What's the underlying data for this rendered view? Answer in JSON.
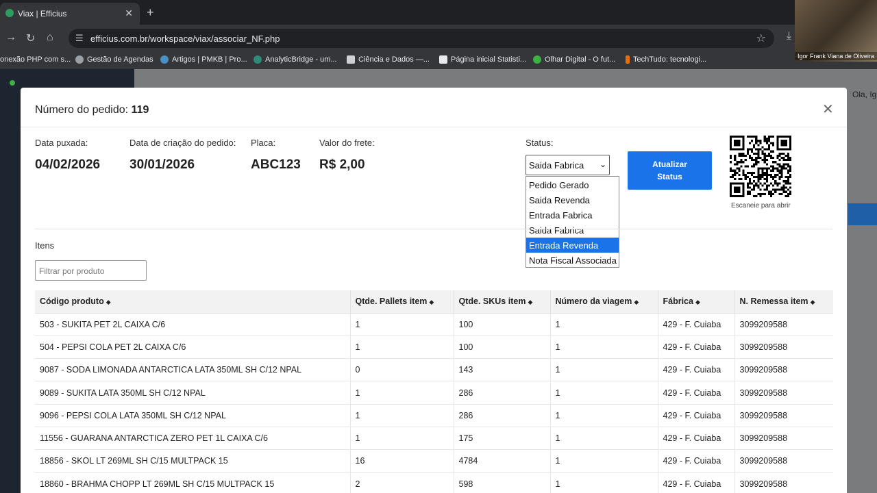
{
  "browser": {
    "tab_title": "Viax | Efficius",
    "url": "efficius.com.br/workspace/viax/associar_NF.php",
    "bookmarks": [
      "onexão PHP com s...",
      "Gestão de Agendas",
      "Artigos | PMKB | Pro...",
      "AnalyticBridge - um...",
      "Ciência e Dados —...",
      "Página inicial Statisti...",
      "Olhar Digital - O fut...",
      "TechTudo: tecnologi..."
    ],
    "webcam_name": "Igor Frank Viana de Oliveira"
  },
  "background_page": {
    "greeting": "Ola, Ig"
  },
  "modal": {
    "title_label": "Número do pedido:",
    "order_number": "119",
    "fields": [
      {
        "label": "Data puxada:",
        "value": "04/02/2026"
      },
      {
        "label": "Data de criação do pedido:",
        "value": "30/01/2026"
      },
      {
        "label": "Placa:",
        "value": "ABC123"
      },
      {
        "label": "Valor do frete:",
        "value": "R$ 2,00"
      }
    ],
    "status_label": "Status:",
    "status_selected": "Saida Fabrica",
    "status_options": [
      "Pedido Gerado",
      "Saida Revenda",
      "Entrada Fabrica",
      "Saida Fabrica",
      "Entrada Revenda",
      "Nota Fiscal Associada"
    ],
    "status_highlighted": "Entrada Revenda",
    "update_button": "Atualizar Status",
    "qr_caption": "Escaneie para abrir",
    "items_title": "Itens",
    "filter_placeholder": "Filtrar por produto",
    "table": {
      "headers": [
        "Código produto",
        "Qtde. Pallets item",
        "Qtde. SKUs item",
        "Número da viagem",
        "Fábrica",
        "N. Remessa item"
      ],
      "rows": [
        [
          "503 - SUKITA PET 2L CAIXA C/6",
          "1",
          "100",
          "1",
          "429 - F. Cuiaba",
          "3099209588"
        ],
        [
          "504 - PEPSI COLA PET 2L CAIXA C/6",
          "1",
          "100",
          "1",
          "429 - F. Cuiaba",
          "3099209588"
        ],
        [
          "9087 - SODA LIMONADA ANTARCTICA LATA 350ML SH C/12 NPAL",
          "0",
          "143",
          "1",
          "429 - F. Cuiaba",
          "3099209588"
        ],
        [
          "9089 - SUKITA LATA 350ML SH C/12 NPAL",
          "1",
          "286",
          "1",
          "429 - F. Cuiaba",
          "3099209588"
        ],
        [
          "9096 - PEPSI COLA LATA 350ML SH C/12 NPAL",
          "1",
          "286",
          "1",
          "429 - F. Cuiaba",
          "3099209588"
        ],
        [
          "11556 - GUARANA ANTARCTICA ZERO PET 1L CAIXA C/6",
          "1",
          "175",
          "1",
          "429 - F. Cuiaba",
          "3099209588"
        ],
        [
          "18856 - SKOL LT 269ML SH C/15 MULTPACK 15",
          "16",
          "4784",
          "1",
          "429 - F. Cuiaba",
          "3099209588"
        ],
        [
          "18860 - BRAHMA CHOPP LT 269ML SH C/15 MULTPACK 15",
          "2",
          "598",
          "1",
          "429 - F. Cuiaba",
          "3099209588"
        ]
      ]
    }
  }
}
